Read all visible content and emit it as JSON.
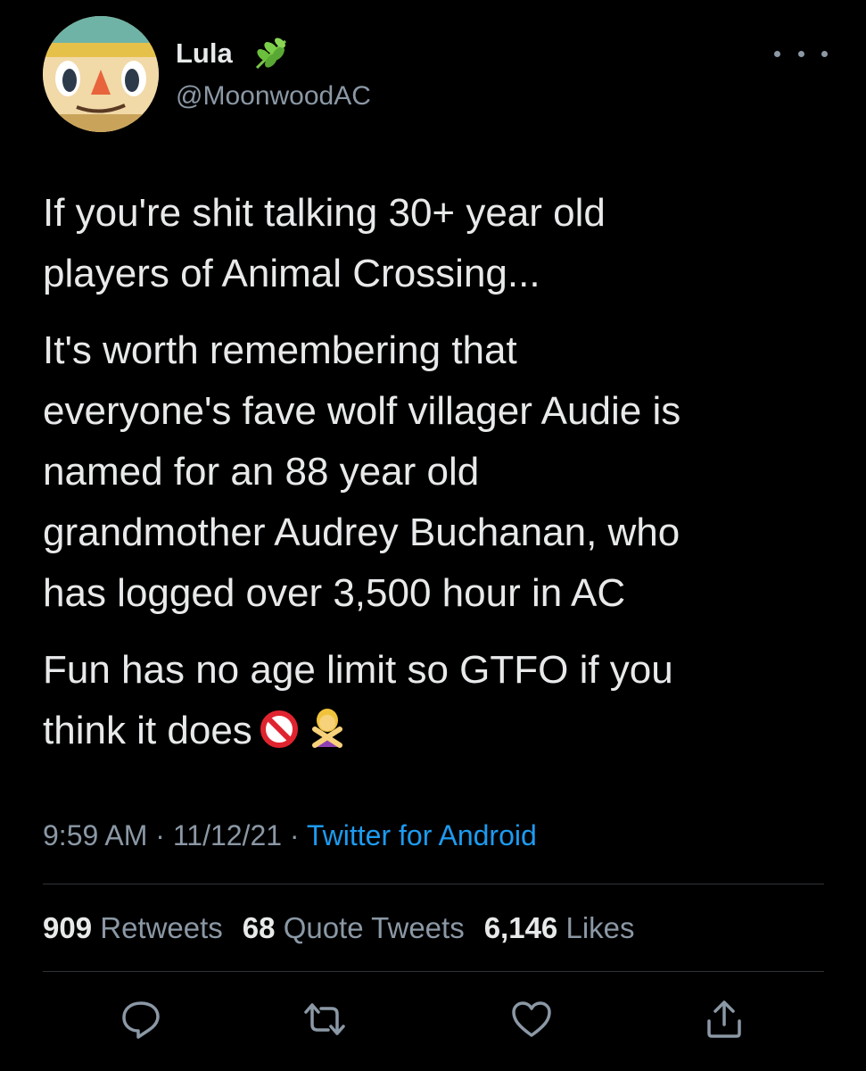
{
  "tweet": {
    "author": {
      "display_name": "Lula",
      "handle": "@MoonwoodAC",
      "name_badge_icon": "herb-leaf-icon"
    },
    "paragraphs": [
      "If you're shit talking 30+ year old\nplayers of Animal Crossing...",
      "It's worth remembering that\neveryone's fave wolf villager Audie is\nnamed for an 88 year old\ngrandmother Audrey Buchanan, who\nhas logged over 3,500 hour in AC",
      "Fun has no age limit so GTFO if you\nthink it does"
    ],
    "trailing_emojis": [
      "no-entry-sign-emoji",
      "person-gesturing-no-emoji"
    ],
    "time": "9:59 AM",
    "date": "11/12/21",
    "separator": "·",
    "source": "Twitter for Android",
    "stats": {
      "retweets_count": "909",
      "retweets_label": "Retweets",
      "quotes_count": "68",
      "quotes_label": "Quote Tweets",
      "likes_count": "6,146",
      "likes_label": "Likes"
    },
    "actions": [
      "reply-icon",
      "retweet-icon",
      "like-icon",
      "share-icon"
    ]
  },
  "colors": {
    "background": "#000000",
    "primary_text": "#e7e9ea",
    "secondary_text": "#8b98a5",
    "link": "#1d9bf0",
    "divider": "#2f3336"
  }
}
